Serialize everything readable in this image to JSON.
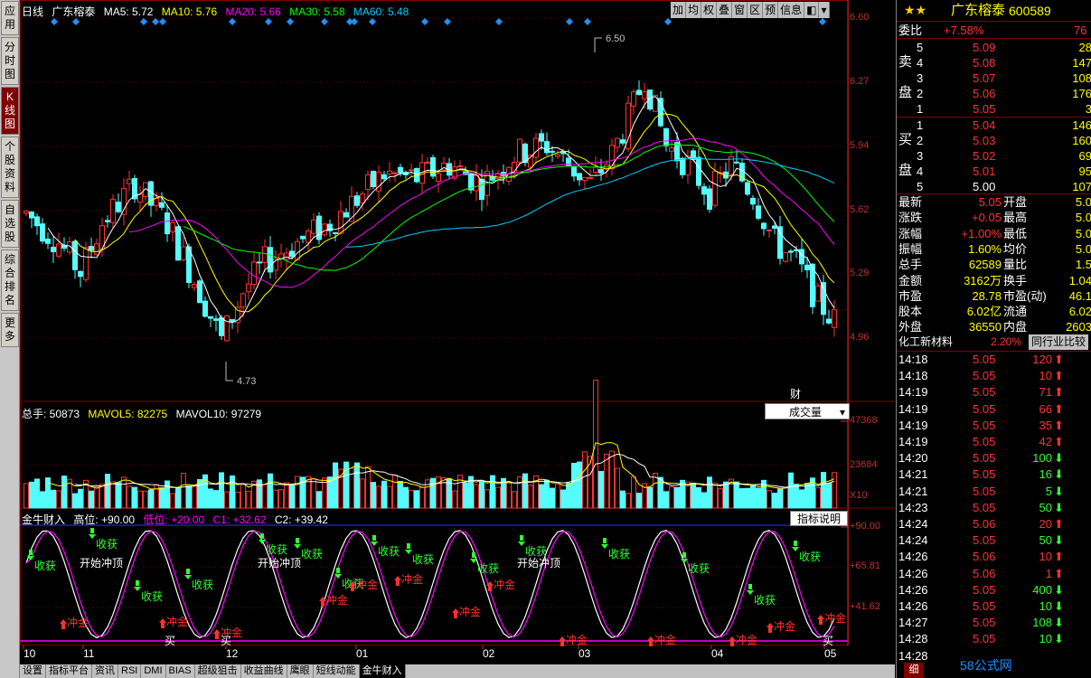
{
  "tabs": [
    "应用",
    "分时图",
    "K线图",
    "个股资料",
    "自选股",
    "综合排名",
    "更多"
  ],
  "active_tab": 2,
  "period": "日线",
  "stock_name": "广东榕泰",
  "stock_code": "600589",
  "ma": {
    "ma5": "MA5: 5.72",
    "ma10": "MA10: 5.76",
    "ma20": "MA20: 5.66",
    "ma30": "MA30: 5.58",
    "ma60": "MA60: 5.48"
  },
  "toolbar": [
    "加",
    "均",
    "权",
    "叠",
    "窗",
    "区",
    "预",
    "信息"
  ],
  "price_axis": [
    "6.60",
    "6.27",
    "5.94",
    "5.62",
    "5.29",
    "4.96"
  ],
  "high_mark": "6.50",
  "low_mark": "4.73",
  "fin_badge": "财",
  "vol": {
    "zs": "总手: 50873",
    "mavol5": "MAVOL5: 82275",
    "mavol10": "MAVOL10: 97279",
    "dropdown": "成交量",
    "axis": [
      "47368",
      "23684",
      "X10"
    ]
  },
  "ind": {
    "name": "金牛财入",
    "gw": "高位: +90.00",
    "dw": "低位: +20.00",
    "c1": "C1: +32.62",
    "c2": "C2: +39.42",
    "btn": "指标说明",
    "axis": [
      "+90.00",
      "+65.81",
      "+41.62"
    ],
    "labels": {
      "shou": "收获",
      "chong": "冲金",
      "mai": "买",
      "kaishi": "开始冲顶"
    }
  },
  "dates": [
    "10",
    "11",
    "12",
    "01",
    "02",
    "03",
    "04",
    "05"
  ],
  "bottom_tabs": [
    "设置",
    "指标平台",
    "资讯",
    "RSI",
    "DMI",
    "BIAS",
    "超级狙击",
    "收益曲线",
    "鹰眼",
    "短线动能",
    "金牛财入"
  ],
  "quote": {
    "weibi": {
      "label": "委比",
      "value": "+7.58%",
      "extra": "76"
    },
    "sell": [
      {
        "n": "5",
        "p": "5.09",
        "v": "28"
      },
      {
        "n": "4",
        "p": "5.08",
        "v": "147"
      },
      {
        "n": "3",
        "p": "5.07",
        "v": "108"
      },
      {
        "n": "2",
        "p": "5.06",
        "v": "176"
      },
      {
        "n": "1",
        "p": "5.05",
        "v": "3"
      }
    ],
    "buy": [
      {
        "n": "1",
        "p": "5.04",
        "v": "146"
      },
      {
        "n": "2",
        "p": "5.03",
        "v": "160"
      },
      {
        "n": "3",
        "p": "5.02",
        "v": "69"
      },
      {
        "n": "4",
        "p": "5.01",
        "v": "95"
      },
      {
        "n": "5",
        "p": "5.00",
        "v": "107"
      }
    ],
    "sell_label": [
      "卖",
      "盘"
    ],
    "buy_label": [
      "买",
      "盘"
    ],
    "stats": [
      {
        "l1": "最新",
        "v1": "5.05",
        "l2": "开盘",
        "v2": "5.0"
      },
      {
        "l1": "涨跌",
        "v1": "+0.05",
        "l2": "最高",
        "v2": "5.0"
      },
      {
        "l1": "涨幅",
        "v1": "+1.00%",
        "l2": "最低",
        "v2": "5.0"
      },
      {
        "l1": "振幅",
        "v1": "1.60%",
        "l2": "均价",
        "v2": "5.0"
      },
      {
        "l1": "总手",
        "v1": "62589",
        "l2": "量比",
        "v2": "1.5"
      },
      {
        "l1": "金额",
        "v1": "3162万",
        "l2": "换手",
        "v2": "1.04"
      },
      {
        "l1": "市盈",
        "v1": "28.78",
        "l2": "市盈(动)",
        "v2": "46.1"
      },
      {
        "l1": "股本",
        "v1": "6.02亿",
        "l2": "流通",
        "v2": "6.02"
      },
      {
        "l1": "外盘",
        "v1": "36550",
        "l2": "内盘",
        "v2": "2603"
      }
    ],
    "industry": {
      "name": "化工新材料",
      "chg": "2.20%",
      "btn": "同行业比较"
    },
    "ticks": [
      {
        "t": "14:18",
        "p": "5.05",
        "v": "120",
        "d": "up"
      },
      {
        "t": "14:18",
        "p": "5.05",
        "v": "10",
        "d": "up"
      },
      {
        "t": "14:19",
        "p": "5.05",
        "v": "71",
        "d": "up"
      },
      {
        "t": "14:19",
        "p": "5.05",
        "v": "66",
        "d": "up"
      },
      {
        "t": "14:19",
        "p": "5.05",
        "v": "35",
        "d": "up"
      },
      {
        "t": "14:19",
        "p": "5.05",
        "v": "42",
        "d": "up"
      },
      {
        "t": "14:20",
        "p": "5.05",
        "v": "100",
        "d": "down"
      },
      {
        "t": "14:21",
        "p": "5.05",
        "v": "16",
        "d": "down"
      },
      {
        "t": "14:21",
        "p": "5.05",
        "v": "5",
        "d": "down"
      },
      {
        "t": "14:23",
        "p": "5.05",
        "v": "50",
        "d": "down"
      },
      {
        "t": "14:24",
        "p": "5.06",
        "v": "20",
        "d": "up"
      },
      {
        "t": "14:24",
        "p": "5.05",
        "v": "50",
        "d": "down"
      },
      {
        "t": "14:26",
        "p": "5.06",
        "v": "10",
        "d": "up"
      },
      {
        "t": "14:26",
        "p": "5.06",
        "v": "1",
        "d": "up"
      },
      {
        "t": "14:26",
        "p": "5.05",
        "v": "400",
        "d": "down"
      },
      {
        "t": "14:26",
        "p": "5.05",
        "v": "10",
        "d": "down"
      },
      {
        "t": "14:27",
        "p": "5.05",
        "v": "108",
        "d": "down"
      },
      {
        "t": "14:28",
        "p": "5.05",
        "v": "10",
        "d": "down"
      },
      {
        "t": "14:28",
        "p": ""
      }
    ],
    "bottom_tab": "细",
    "watermark": "58公式网"
  },
  "colors": {
    "up": "#ff3232",
    "down": "#54fcfc",
    "ma5": "#ffffff",
    "ma10": "#ffff00",
    "ma20": "#ff00ff",
    "ma30": "#00ff00",
    "ma60": "#00ccff"
  }
}
